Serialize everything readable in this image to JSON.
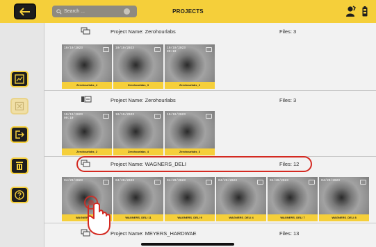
{
  "header": {
    "title": "PROJECTS",
    "search_placeholder": "Search ..."
  },
  "sidebar": {
    "items": [
      {
        "name": "gallery-icon",
        "state": "active"
      },
      {
        "name": "delete-image-icon",
        "state": "disabled"
      },
      {
        "name": "export-icon",
        "state": "active"
      },
      {
        "name": "trash-icon",
        "state": "active"
      },
      {
        "name": "help-icon",
        "state": "active"
      }
    ]
  },
  "projects": [
    {
      "name": "Project Name: Zerohourlabs",
      "files": "Files: 3",
      "thumbnails": [
        {
          "stamp": "10/19/2023",
          "caption": "Zerohourlabs_4"
        },
        {
          "stamp": "10/19/2023",
          "caption": "Zerohourlabs_3"
        },
        {
          "stamp": "10/19/2023\n00:19",
          "caption": "Zerohourlabs_2"
        }
      ]
    },
    {
      "name": "Project Name: Zerohourlabs",
      "files": "Files: 3",
      "thumbnails": [
        {
          "stamp": "10/19/2023\n00:19",
          "caption": "Zerohourlabs_2"
        },
        {
          "stamp": "10/19/2023",
          "caption": "Zerohourlabs_4"
        },
        {
          "stamp": "10/19/2023",
          "caption": "Zerohourlabs_3"
        }
      ]
    },
    {
      "name": "Project Name: WAGNERS_DELI",
      "files": "Files: 12",
      "thumbnails": [
        {
          "stamp": "04/20/2023",
          "caption": "WAGNERS_DELI"
        },
        {
          "stamp": "04/20/2023",
          "caption": "WAGNERS_DELI 11"
        },
        {
          "stamp": "04/20/2023",
          "caption": "WAGNERS_DELI 9"
        },
        {
          "stamp": "04/20/2023",
          "caption": "WAGNERS_DELI 4"
        },
        {
          "stamp": "04/20/2023",
          "caption": "WAGNERS_DELI 7"
        },
        {
          "stamp": "04/20/2023",
          "caption": "WAGNERS_DELI 8"
        }
      ]
    },
    {
      "name": "Project Name: MEYERS_HARDWAE",
      "files": "Files: 13",
      "thumbnails": []
    }
  ],
  "colors": {
    "accent": "#f5cf3a",
    "highlight": "#d42a22",
    "dark": "#1e1e1e"
  }
}
